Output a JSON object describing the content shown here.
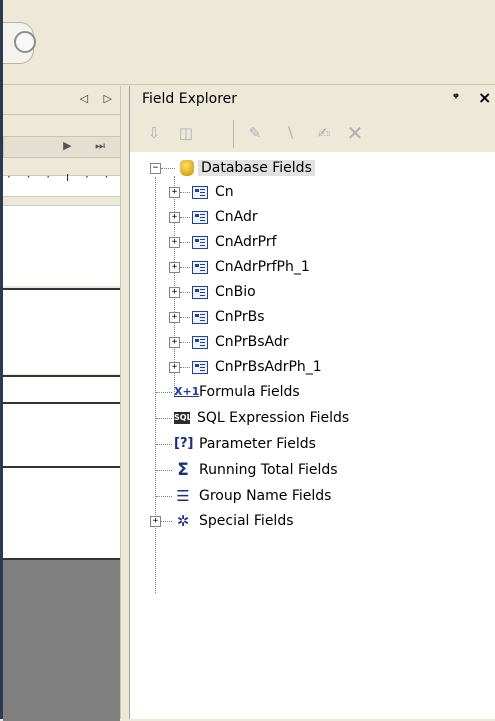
{
  "left_pane": {
    "tab_arrows": "◁ ▷",
    "nav_buttons": "▶ ⏭",
    "ruler_ticks": "· · · ı · ·"
  },
  "field_explorer": {
    "title": "Field Explorer",
    "pin_icon": "pin-icon",
    "close_icon": "close-icon",
    "toolbar": [
      {
        "name": "insert-to-report-icon"
      },
      {
        "name": "browse-data-icon"
      },
      {
        "name": "new-icon"
      },
      {
        "name": "edit-icon"
      },
      {
        "name": "rename-icon"
      },
      {
        "name": "delete-icon"
      }
    ],
    "tree": {
      "database_fields": "Database Fields",
      "tables": [
        "Cn",
        "CnAdr",
        "CnAdrPrf",
        "CnAdrPrfPh_1",
        "CnBio",
        "CnPrBs",
        "CnPrBsAdr",
        "CnPrBsAdrPh_1"
      ],
      "formula_fields": "Formula Fields",
      "sql_expression_fields": "SQL Expression Fields",
      "parameter_fields": "Parameter Fields",
      "running_total_fields": "Running Total Fields",
      "group_name_fields": "Group Name Fields",
      "special_fields": "Special Fields"
    }
  }
}
